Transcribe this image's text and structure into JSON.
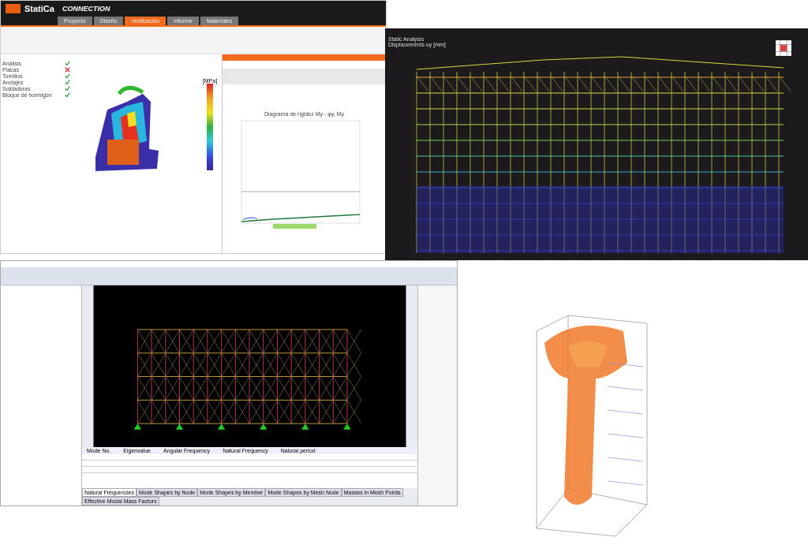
{
  "connection_app": {
    "brand": "StatiCa",
    "product": "CONNECTION",
    "ribbon_tabs": [
      {
        "label": "Proyecto",
        "selected": false
      },
      {
        "label": "Diseño",
        "selected": false
      },
      {
        "label": "Verificación",
        "selected": true
      },
      {
        "label": "Informe",
        "selected": false
      },
      {
        "label": "Materiales",
        "selected": false
      }
    ],
    "checks": [
      {
        "label": "Análisis",
        "passed": true
      },
      {
        "label": "Placas",
        "passed": false
      },
      {
        "label": "Tornillos",
        "passed": true
      },
      {
        "label": "Anclajes",
        "passed": true
      },
      {
        "label": "Soldaduras",
        "passed": true
      },
      {
        "label": "Bloque de hormigón",
        "passed": true
      }
    ],
    "stress_unit": "[MPa]",
    "chart_title": "Diagrama de rigidez My - φy, My"
  },
  "analysis_view": {
    "lines": [
      "Static Analysis",
      "Displacements uy [mm]"
    ]
  },
  "rfem": {
    "table_columns": [
      "Mode No.",
      "Eigenvalue",
      "Angular Frequency",
      "Natural Frequency",
      "Natural period"
    ],
    "result_tabs": [
      {
        "label": "Natural Frequencies",
        "selected": true
      },
      {
        "label": "Mode Shapes by Node",
        "selected": false
      },
      {
        "label": "Mode Shapes by Member",
        "selected": false
      },
      {
        "label": "Mode Shapes by Mesh Node",
        "selected": false
      },
      {
        "label": "Masses in Mesh Points",
        "selected": false
      },
      {
        "label": "Effective Modal Mass Factors",
        "selected": false
      }
    ]
  }
}
